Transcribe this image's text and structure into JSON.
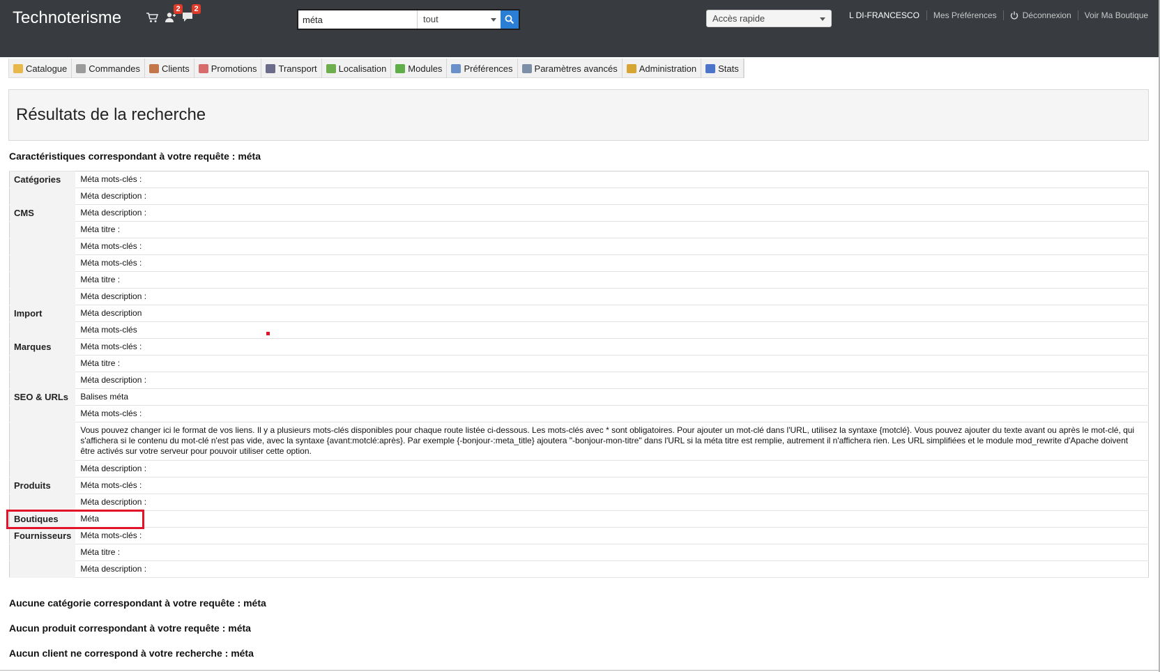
{
  "header": {
    "brand": "Technoterisme",
    "notifications": [
      {
        "icon": "cart-icon",
        "count": ""
      },
      {
        "icon": "customers-icon",
        "count": "2"
      },
      {
        "icon": "messages-icon",
        "count": "2"
      }
    ],
    "search": {
      "value": "méta",
      "scope": "tout"
    },
    "quick_access": "Accès rapide",
    "user": "L DI-FRANCESCO",
    "links": {
      "preferences": "Mes Préférences",
      "logout": "Déconnexion",
      "shop": "Voir Ma Boutique"
    }
  },
  "menu": [
    {
      "label": "Catalogue",
      "icon": "folder-icon",
      "color": "#e8b84a"
    },
    {
      "label": "Commandes",
      "icon": "cart-icon",
      "color": "#9b9b9b"
    },
    {
      "label": "Clients",
      "icon": "user-icon",
      "color": "#c2764a"
    },
    {
      "label": "Promotions",
      "icon": "promo-icon",
      "color": "#d86b6b"
    },
    {
      "label": "Transport",
      "icon": "truck-icon",
      "color": "#6b6b8a"
    },
    {
      "label": "Localisation",
      "icon": "globe-icon",
      "color": "#6fae4e"
    },
    {
      "label": "Modules",
      "icon": "puzzle-icon",
      "color": "#5fae4a"
    },
    {
      "label": "Préférences",
      "icon": "preferences-icon",
      "color": "#6a90c9"
    },
    {
      "label": "Paramètres avancés",
      "icon": "wrench-icon",
      "color": "#7d8fa7"
    },
    {
      "label": "Administration",
      "icon": "key-icon",
      "color": "#d7a531"
    },
    {
      "label": "Stats",
      "icon": "chart-icon",
      "color": "#4c74c9"
    }
  ],
  "page_title": "Résultats de la recherche",
  "features_heading": "Caractéristiques correspondant à votre requête : méta",
  "results": [
    {
      "category": "Catégories",
      "value": "Méta mots-clés :"
    },
    {
      "category": "",
      "value": "Méta description :"
    },
    {
      "category": "CMS",
      "value": "Méta description :"
    },
    {
      "category": "",
      "value": "Méta titre :"
    },
    {
      "category": "",
      "value": "Méta mots-clés :"
    },
    {
      "category": "",
      "value": "Méta mots-clés :"
    },
    {
      "category": "",
      "value": "Méta titre :"
    },
    {
      "category": "",
      "value": "Méta description :"
    },
    {
      "category": "Import",
      "value": "Méta description"
    },
    {
      "category": "",
      "value": "Méta mots-clés"
    },
    {
      "category": "Marques",
      "value": "Méta mots-clés :"
    },
    {
      "category": "",
      "value": "Méta titre :"
    },
    {
      "category": "",
      "value": "Méta description :"
    },
    {
      "category": "SEO & URLs",
      "value": "Balises méta"
    },
    {
      "category": "",
      "value": "Méta mots-clés :"
    },
    {
      "category": "",
      "value": "Vous pouvez changer ici le format de vos liens. Il y a plusieurs mots-clés disponibles pour chaque route listée ci-dessous. Les mots-clés avec * sont obligatoires. Pour ajouter un mot-clé dans l'URL, utilisez la syntaxe {motclé}. Vous pouvez ajouter du texte avant ou après le mot-clé, qui s'affichera si le contenu du mot-clé n'est pas vide, avec la syntaxe {avant:motclé:après}. Par exemple {-bonjour-:meta_title} ajoutera \"-bonjour-mon-titre\" dans l'URL si la méta titre est remplie, autrement il n'affichera rien. Les URL simplifiées et le module mod_rewrite d'Apache doivent être activés sur votre serveur pour pouvoir utiliser cette option."
    },
    {
      "category": "",
      "value": "Méta description :"
    },
    {
      "category": "Produits",
      "value": "Méta mots-clés :"
    },
    {
      "category": "",
      "value": "Méta description :"
    },
    {
      "category": "Boutiques",
      "value": "Méta"
    },
    {
      "category": "Fournisseurs",
      "value": "Méta mots-clés :"
    },
    {
      "category": "",
      "value": "Méta titre :"
    },
    {
      "category": "",
      "value": "Méta description :"
    }
  ],
  "no_results": [
    "Aucune catégorie correspondant à votre requête : méta",
    "Aucun produit correspondant à votre requête : méta",
    "Aucun client ne correspond à votre recherche : méta"
  ],
  "colors": {
    "header_bg": "#383b3f",
    "search_button": "#2a7fd4",
    "badge": "#e03a2b",
    "highlight": "#e3132a"
  }
}
